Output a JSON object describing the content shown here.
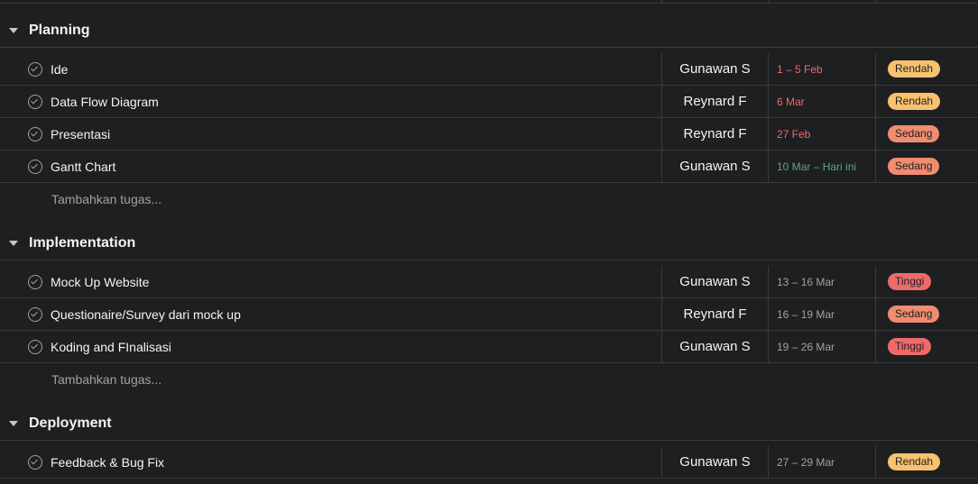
{
  "colors": {
    "background": "#1e1f21",
    "divider": "#3a3b3d",
    "date_overdue": "#f06a6a",
    "date_today": "#5da283",
    "date_normal": "#a2a0a2",
    "priority_rendah": "#f8c26f",
    "priority_sedang": "#f08c6f",
    "priority_tinggi": "#f06a6a"
  },
  "add_task_placeholder": "Tambahkan tugas...",
  "sections": [
    {
      "title": "Planning",
      "tasks": [
        {
          "name": "Ide",
          "assignee": "Gunawan S",
          "date": "1 – 5 Feb",
          "date_status": "overdue",
          "priority": "Rendah"
        },
        {
          "name": "Data Flow Diagram",
          "assignee": "Reynard F",
          "date": "6 Mar",
          "date_status": "overdue",
          "priority": "Rendah"
        },
        {
          "name": "Presentasi",
          "assignee": "Reynard F",
          "date": "27 Feb",
          "date_status": "overdue",
          "priority": "Sedang"
        },
        {
          "name": "Gantt Chart",
          "assignee": "Gunawan S",
          "date": "10 Mar – Hari ini",
          "date_status": "today",
          "priority": "Sedang"
        }
      ]
    },
    {
      "title": "Implementation",
      "tasks": [
        {
          "name": "Mock Up Website",
          "assignee": "Gunawan S",
          "date": "13 – 16 Mar",
          "date_status": "normal",
          "priority": "Tinggi"
        },
        {
          "name": "Questionaire/Survey dari mock up",
          "assignee": "Reynard F",
          "date": "16 – 19 Mar",
          "date_status": "normal",
          "priority": "Sedang"
        },
        {
          "name": "Koding and FInalisasi",
          "assignee": "Gunawan S",
          "date": "19 – 26 Mar",
          "date_status": "normal",
          "priority": "Tinggi"
        }
      ]
    },
    {
      "title": "Deployment",
      "tasks": [
        {
          "name": "Feedback & Bug Fix",
          "assignee": "Gunawan S",
          "date": "27 – 29 Mar",
          "date_status": "normal",
          "priority": "Rendah"
        }
      ]
    }
  ]
}
